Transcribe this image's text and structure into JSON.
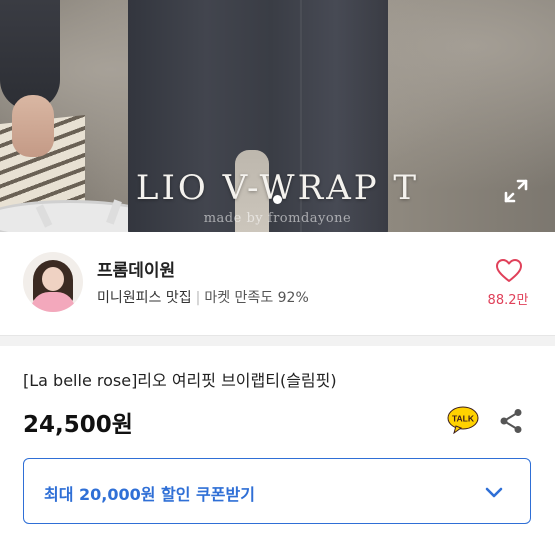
{
  "hero": {
    "title": "LIO V-WRAP T",
    "credit": "made by fromdayone"
  },
  "shop": {
    "name": "프롬데이원",
    "tagline": "미니원피스 맛집",
    "satisfaction": "마켓 만족도 92%",
    "likes": "88.2만"
  },
  "product": {
    "title": "[La belle rose]리오 여리핏 브이랩티(슬림핏)",
    "price": "24,500원",
    "talk_label": "TALK"
  },
  "coupon": {
    "label": "최대 20,000원 할인 쿠폰받기"
  },
  "colors": {
    "accent": "#2f6fd6",
    "like": "#e0415a",
    "kakao": "#ffd200"
  },
  "icons": [
    "expand-icon",
    "heart-icon",
    "kakaotalk-icon",
    "share-icon",
    "chevron-down-icon"
  ]
}
